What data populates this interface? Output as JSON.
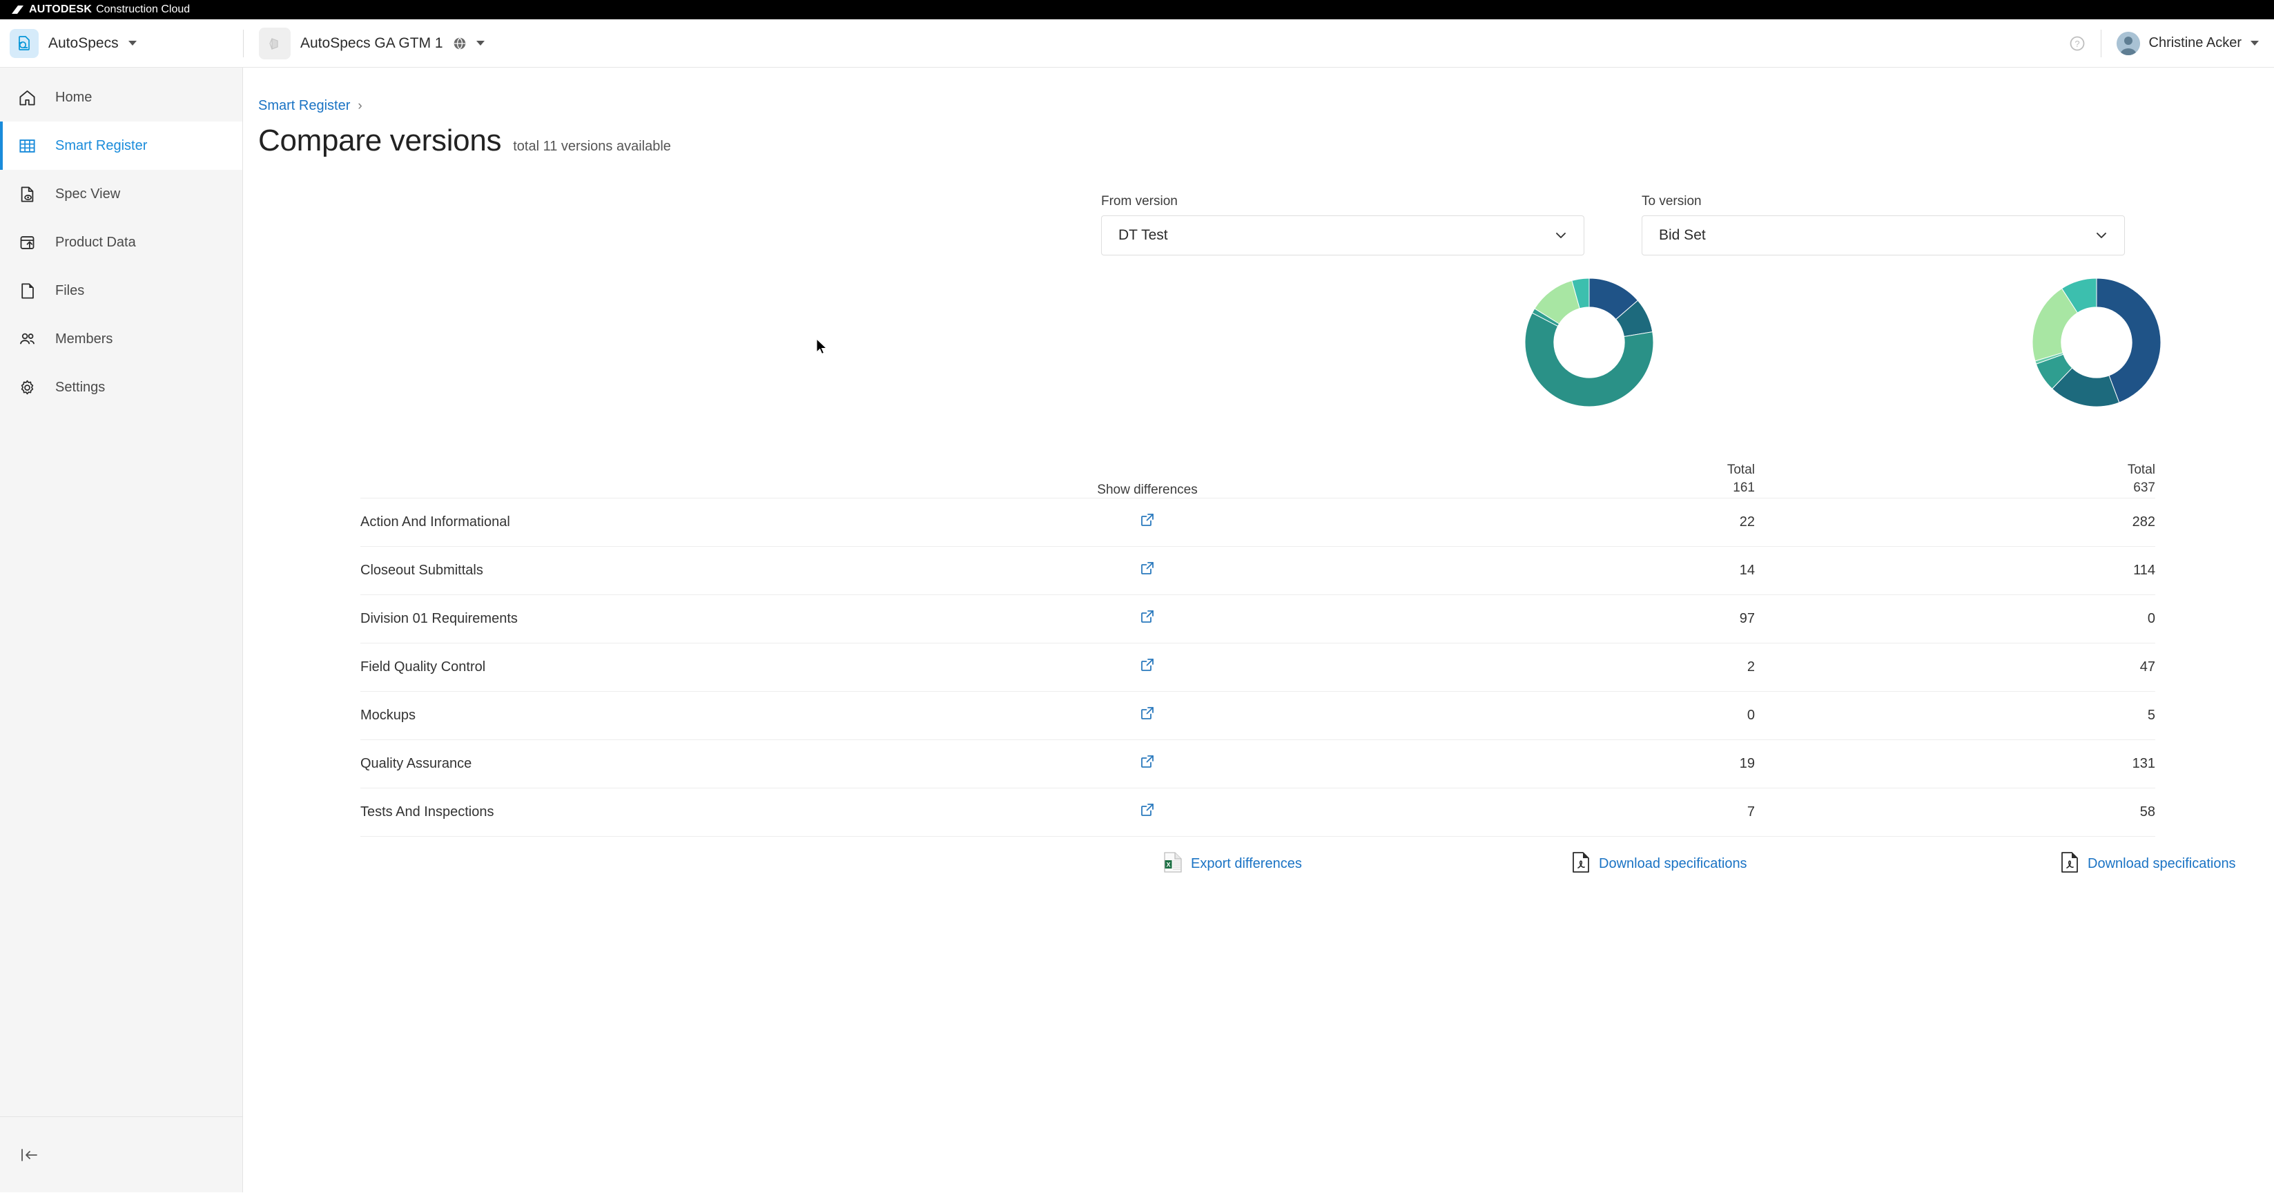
{
  "brand": {
    "autodesk": "AUTODESK",
    "suite": "Construction Cloud",
    "logo_icon": "autodesk-logo-icon"
  },
  "header": {
    "product_name": "AutoSpecs",
    "product_icon": "autospecs-product-icon",
    "product_caret_icon": "caret-down-icon",
    "project_name": "AutoSpecs GA GTM 1",
    "project_icon": "project-thumbnail-icon",
    "project_globe_icon": "globe-icon",
    "project_caret_icon": "caret-down-icon",
    "help_icon": "help-circle-icon",
    "avatar_icon": "user-avatar-icon",
    "user_name": "Christine Acker",
    "user_caret_icon": "caret-down-icon"
  },
  "sidebar": {
    "collapse_icon": "collapse-sidebar-icon",
    "items": [
      {
        "label": "Home",
        "icon": "home-icon",
        "active": false
      },
      {
        "label": "Smart Register",
        "icon": "table-grid-icon",
        "active": true
      },
      {
        "label": "Spec View",
        "icon": "document-eye-icon",
        "active": false
      },
      {
        "label": "Product Data",
        "icon": "upload-box-icon",
        "active": false
      },
      {
        "label": "Files",
        "icon": "file-icon",
        "active": false
      },
      {
        "label": "Members",
        "icon": "people-icon",
        "active": false
      },
      {
        "label": "Settings",
        "icon": "gear-icon",
        "active": false
      }
    ]
  },
  "breadcrumb": {
    "link": "Smart Register",
    "separator": "›"
  },
  "page": {
    "title": "Compare versions",
    "subtitle": "total 11 versions available"
  },
  "selectors": {
    "from": {
      "label": "From version",
      "value": "DT Test",
      "chevron_icon": "chevron-down-icon"
    },
    "to": {
      "label": "To version",
      "value": "Bid Set",
      "chevron_icon": "chevron-down-icon"
    }
  },
  "table": {
    "headers": {
      "name": "",
      "differences": "Show differences",
      "total_label": "Total",
      "from_total": "161",
      "to_total": "637"
    },
    "diff_icon": "external-link-icon",
    "rows": [
      {
        "name": "Action And Informational",
        "from": "22",
        "to": "282"
      },
      {
        "name": "Closeout Submittals",
        "from": "14",
        "to": "114"
      },
      {
        "name": "Division 01 Requirements",
        "from": "97",
        "to": "0"
      },
      {
        "name": "Field Quality Control",
        "from": "2",
        "to": "47"
      },
      {
        "name": "Mockups",
        "from": "0",
        "to": "5"
      },
      {
        "name": "Quality Assurance",
        "from": "19",
        "to": "131"
      },
      {
        "name": "Tests And Inspections",
        "from": "7",
        "to": "58"
      }
    ]
  },
  "footer_actions": [
    {
      "label": "Export differences",
      "icon": "excel-file-icon"
    },
    {
      "label": "Download specifications",
      "icon": "pdf-file-icon"
    },
    {
      "label": "Download specifications",
      "icon": "pdf-file-icon"
    }
  ],
  "colors": {
    "accent_blue": "#1a8cdb",
    "link_blue": "#1a73c4",
    "sidebar_bg": "#f5f5f5",
    "palette": [
      "#1f5387",
      "#1d6a7d",
      "#2a9187",
      "#3cbfae",
      "#a8e6a3",
      "#1f5387",
      "#2a9187"
    ]
  },
  "chart_data": [
    {
      "type": "pie",
      "title": "From version distribution",
      "subtitle": "DT Test",
      "total": 161,
      "categories": [
        "Action And Informational",
        "Closeout Submittals",
        "Division 01 Requirements",
        "Field Quality Control",
        "Mockups",
        "Quality Assurance",
        "Tests And Inspections"
      ],
      "values": [
        22,
        14,
        97,
        2,
        0,
        19,
        7
      ],
      "colors": [
        "#1f5387",
        "#1d6a7d",
        "#2a9187",
        "#2f9e90",
        "#63c9a8",
        "#a8e6a3",
        "#3cbfae"
      ],
      "legend": "none",
      "donut_hole_ratio": 0.55
    },
    {
      "type": "pie",
      "title": "To version distribution",
      "subtitle": "Bid Set",
      "total": 637,
      "categories": [
        "Action And Informational",
        "Closeout Submittals",
        "Division 01 Requirements",
        "Field Quality Control",
        "Mockups",
        "Quality Assurance",
        "Tests And Inspections"
      ],
      "values": [
        282,
        114,
        0,
        47,
        5,
        131,
        58
      ],
      "colors": [
        "#1f5387",
        "#1d6a7d",
        "#2a9187",
        "#2f9e90",
        "#63c9a8",
        "#a8e6a3",
        "#3cbfae"
      ],
      "legend": "none",
      "donut_hole_ratio": 0.55
    }
  ]
}
